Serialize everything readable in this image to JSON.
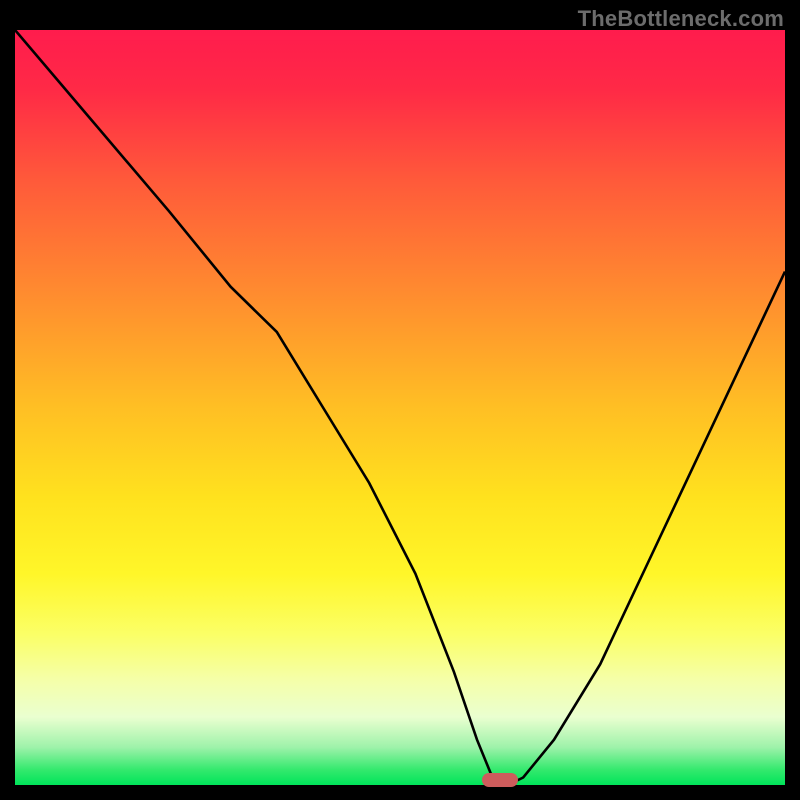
{
  "watermark": "TheBottleneck.com",
  "colors": {
    "frame": "#000000",
    "gradient_stops": [
      {
        "pct": 0,
        "color": "#ff1c4d"
      },
      {
        "pct": 8,
        "color": "#ff2a46"
      },
      {
        "pct": 20,
        "color": "#ff5a3a"
      },
      {
        "pct": 35,
        "color": "#ff8c2f"
      },
      {
        "pct": 50,
        "color": "#ffbf24"
      },
      {
        "pct": 62,
        "color": "#ffe21e"
      },
      {
        "pct": 72,
        "color": "#fff629"
      },
      {
        "pct": 80,
        "color": "#fbff66"
      },
      {
        "pct": 86,
        "color": "#f5ffa8"
      },
      {
        "pct": 91,
        "color": "#eaffd0"
      },
      {
        "pct": 95,
        "color": "#9ef2aa"
      },
      {
        "pct": 98,
        "color": "#33e96d"
      },
      {
        "pct": 100,
        "color": "#00e45a"
      }
    ],
    "curve": "#000000",
    "marker": "#cd5c5c"
  },
  "chart_data": {
    "type": "line",
    "title": "",
    "xlabel": "",
    "ylabel": "",
    "xlim": [
      0,
      100
    ],
    "ylim": [
      0,
      100
    ],
    "marker": {
      "x": 63,
      "y": 0
    },
    "series": [
      {
        "name": "bottleneck-curve",
        "x": [
          0,
          10,
          20,
          28,
          34,
          40,
          46,
          52,
          57,
          60,
          62,
          63,
          64,
          66,
          70,
          76,
          82,
          88,
          94,
          100
        ],
        "values": [
          100,
          88,
          76,
          66,
          60,
          50,
          40,
          28,
          15,
          6,
          1,
          0,
          0,
          1,
          6,
          16,
          29,
          42,
          55,
          68
        ]
      }
    ]
  }
}
